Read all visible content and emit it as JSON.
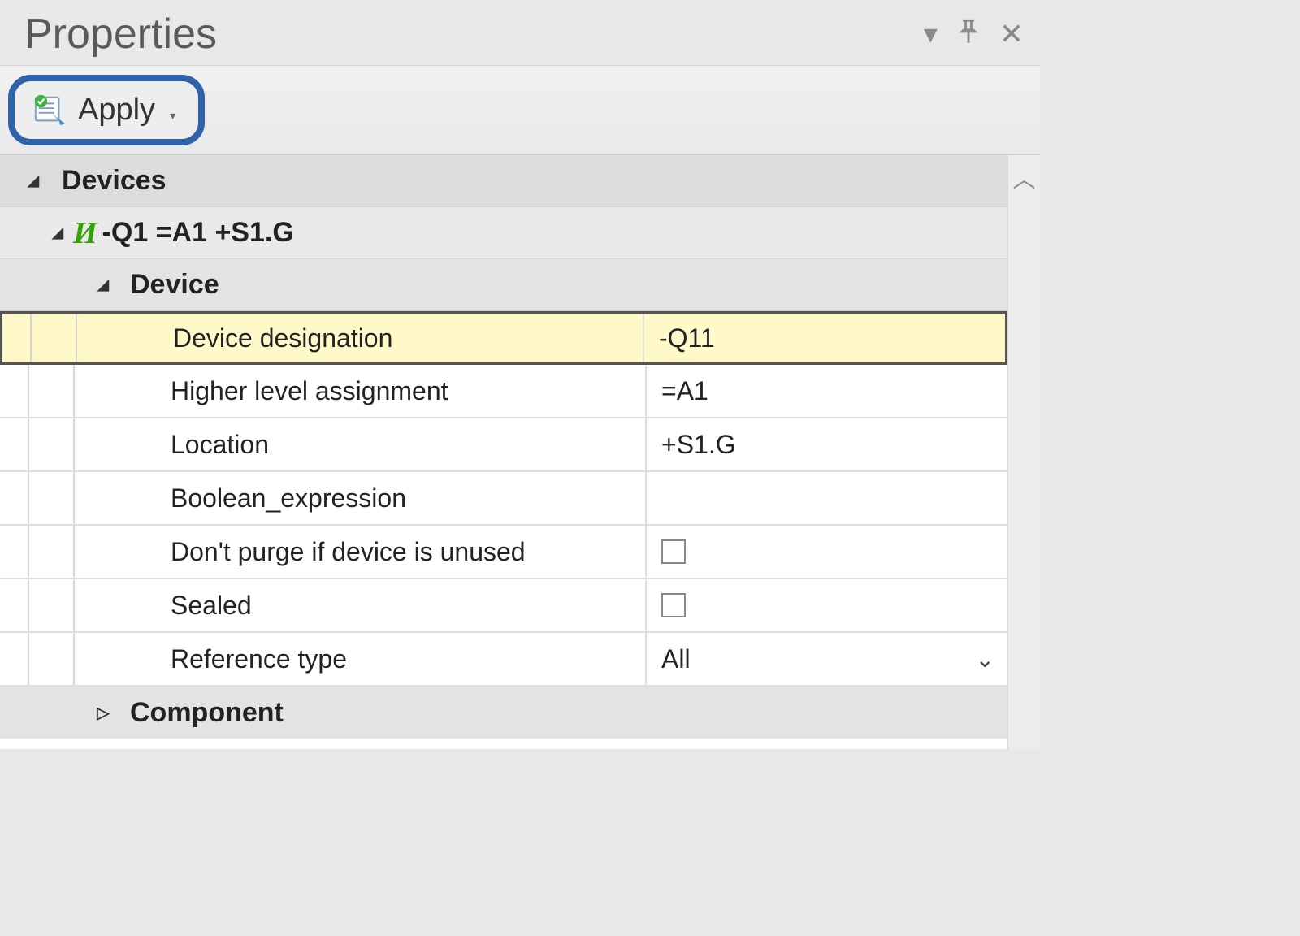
{
  "panel": {
    "title": "Properties"
  },
  "toolbar": {
    "apply_label": "Apply"
  },
  "sections": {
    "devices": "Devices",
    "item_name": "-Q1 =A1 +S1.G",
    "device": "Device",
    "component": "Component"
  },
  "props": {
    "device_designation": {
      "label": "Device designation",
      "value": "-Q11"
    },
    "higher_level": {
      "label": "Higher level assignment",
      "value": "=A1"
    },
    "location": {
      "label": "Location",
      "value": "+S1.G"
    },
    "boolean_expression": {
      "label": "Boolean_expression",
      "value": ""
    },
    "dont_purge": {
      "label": "Don't purge if device is unused",
      "value": ""
    },
    "sealed": {
      "label": "Sealed",
      "value": ""
    },
    "reference_type": {
      "label": "Reference type",
      "value": "All"
    }
  }
}
